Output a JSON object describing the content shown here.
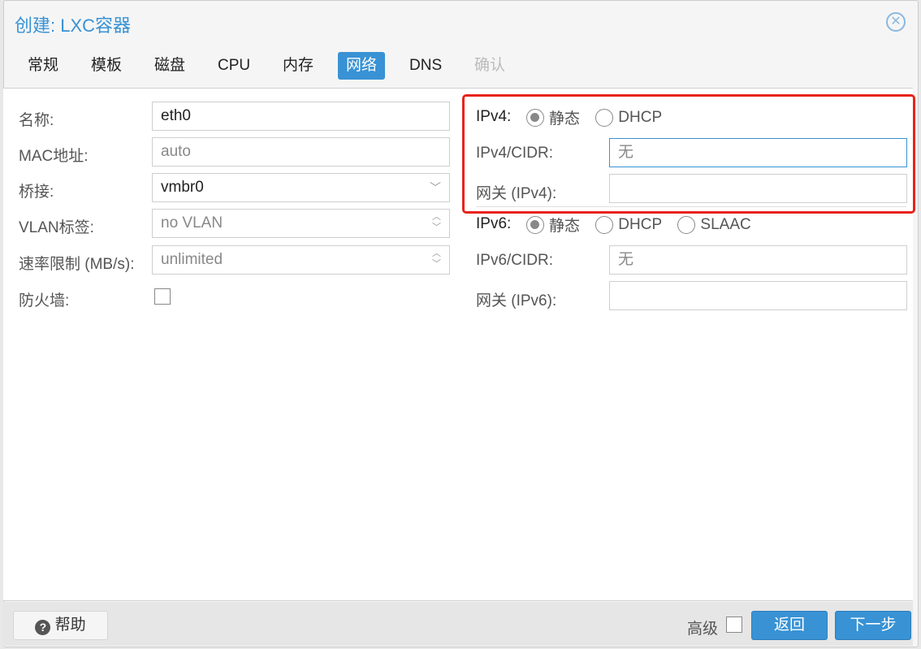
{
  "dialog": {
    "title": "创建: LXC容器",
    "close_icon": "close-icon"
  },
  "tabs": [
    {
      "label": "常规"
    },
    {
      "label": "模板"
    },
    {
      "label": "磁盘"
    },
    {
      "label": "CPU"
    },
    {
      "label": "内存"
    },
    {
      "label": "网络",
      "active": true
    },
    {
      "label": "DNS"
    },
    {
      "label": "确认",
      "disabled": true
    }
  ],
  "left": {
    "name": {
      "label": "名称:",
      "value": "eth0"
    },
    "mac": {
      "label": "MAC地址:",
      "placeholder": "auto"
    },
    "bridge": {
      "label": "桥接:",
      "value": "vmbr0"
    },
    "vlan": {
      "label": "VLAN标签:",
      "placeholder": "no VLAN"
    },
    "rate": {
      "label": "速率限制 (MB/s):",
      "placeholder": "unlimited"
    },
    "firewall": {
      "label": "防火墙:",
      "checked": false
    }
  },
  "right": {
    "ipv4": {
      "label": "IPv4:",
      "options": [
        "静态",
        "DHCP"
      ],
      "selected": "静态"
    },
    "ipv4_cidr": {
      "label": "IPv4/CIDR:",
      "placeholder": "无"
    },
    "gw4": {
      "label": "网关 (IPv4):",
      "value": ""
    },
    "ipv6": {
      "label": "IPv6:",
      "options": [
        "静态",
        "DHCP",
        "SLAAC"
      ],
      "selected": "静态"
    },
    "ipv6_cidr": {
      "label": "IPv6/CIDR:",
      "placeholder": "无"
    },
    "gw6": {
      "label": "网关 (IPv6):",
      "value": ""
    }
  },
  "footer": {
    "help": "帮助",
    "advanced": "高级",
    "back": "返回",
    "next": "下一步"
  },
  "colors": {
    "accent": "#3892d4",
    "highlight": "#e8231b"
  }
}
